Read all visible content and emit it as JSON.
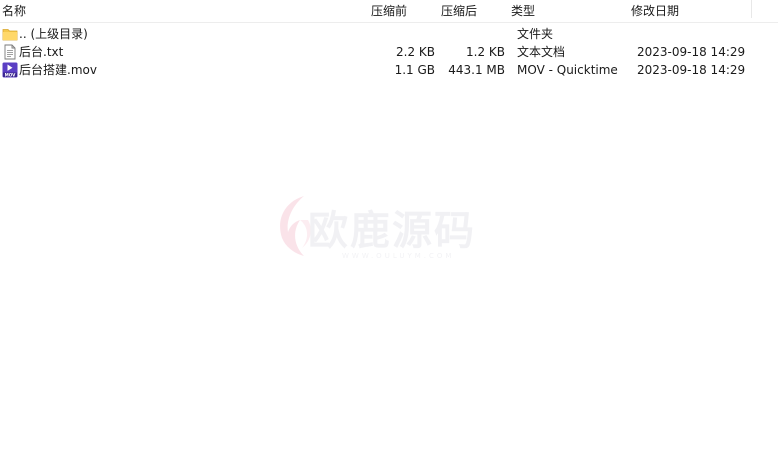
{
  "columns": {
    "name": "名称",
    "packed": "压缩前",
    "size": "压缩后",
    "type": "类型",
    "modified": "修改日期"
  },
  "rows": [
    {
      "icon": "folder-icon",
      "name": ".. (上级目录)",
      "packed": "",
      "size": "",
      "type": "文件夹",
      "modified": ""
    },
    {
      "icon": "text-file-icon",
      "name": "后台.txt",
      "packed": "2.2 KB",
      "size": "1.2 KB",
      "type": "文本文档",
      "modified": "2023-09-18 14:29"
    },
    {
      "icon": "mov-file-icon",
      "name": "后台搭建.mov",
      "packed": "1.1 GB",
      "size": "443.1 MB",
      "type": "MOV - Quicktime",
      "modified": "2023-09-18 14:29"
    }
  ],
  "watermark": {
    "text": "欧鹿源码",
    "subtext": "WWW.OULUYM.COM"
  },
  "colors": {
    "folder": "#f5c84c",
    "mov_icon": "#5b3fc4"
  }
}
